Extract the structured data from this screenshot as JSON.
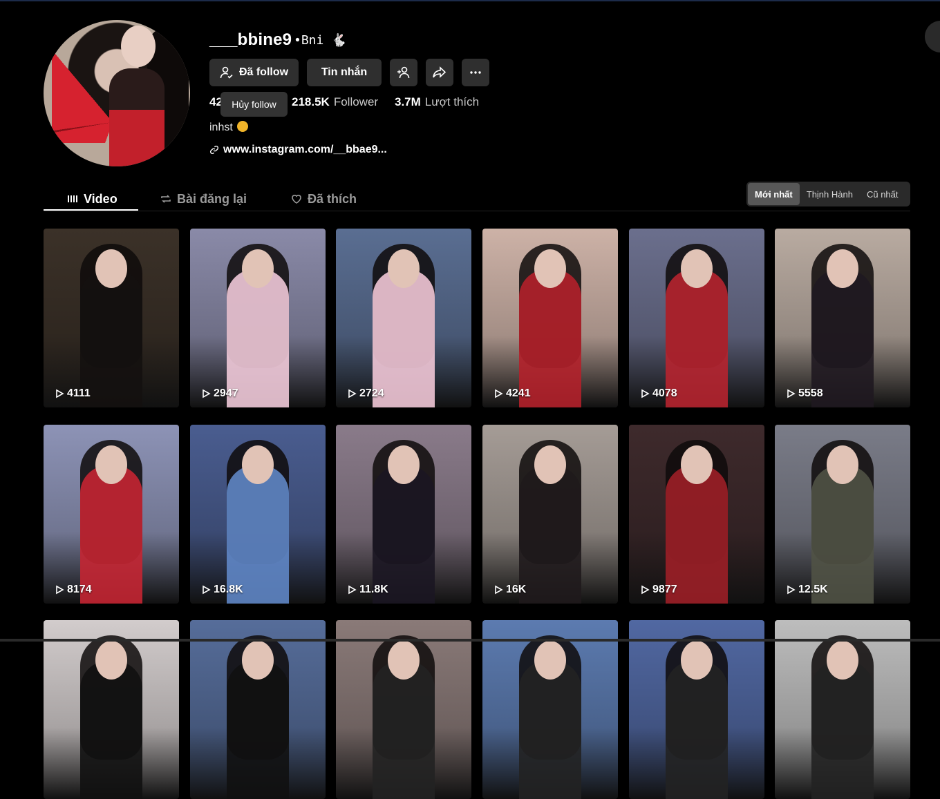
{
  "profile": {
    "username": "___bbine9",
    "nickname": "•Bni 🐇",
    "buttons": {
      "follow_label": "Đã follow",
      "message_label": "Tin nhắn"
    },
    "tooltip": "Hủy follow",
    "stats": {
      "following_value": "42",
      "follower_value": "218.5K",
      "follower_label": "Follower",
      "likes_value": "3.7M",
      "likes_label": "Lượt thích"
    },
    "bio": "inhst",
    "link": "www.instagram.com/__bbae9..."
  },
  "tabs": [
    {
      "label": "Video",
      "icon": "grid-icon",
      "active": true
    },
    {
      "label": "Bài đăng lại",
      "icon": "repost-icon",
      "active": false
    },
    {
      "label": "Đã thích",
      "icon": "heart-icon",
      "active": false
    }
  ],
  "sort": [
    {
      "label": "Mới nhất",
      "active": true
    },
    {
      "label": "Thịnh Hành",
      "active": false
    },
    {
      "label": "Cũ nhất",
      "active": false
    }
  ],
  "videos": [
    {
      "views": "4111",
      "bg": "#3b3128",
      "fig": "#141110"
    },
    {
      "views": "2947",
      "bg": "#8a8aa8",
      "fig": "#f0c9d8"
    },
    {
      "views": "2724",
      "bg": "#5a6e92",
      "fig": "#f1c6d6"
    },
    {
      "views": "4241",
      "bg": "#cdb2a7",
      "fig": "#b3202a"
    },
    {
      "views": "4078",
      "bg": "#6b6f8d",
      "fig": "#b6232f"
    },
    {
      "views": "5558",
      "bg": "#b9aba1",
      "fig": "#1f1820"
    },
    {
      "views": "8174",
      "bg": "#8d93b6",
      "fig": "#c42532"
    },
    {
      "views": "16.8K",
      "bg": "#4a5d90",
      "fig": "#5f86c5"
    },
    {
      "views": "11.8K",
      "bg": "#8a7b8a",
      "fig": "#1b1622"
    },
    {
      "views": "16K",
      "bg": "#a59c96",
      "fig": "#1f1a1c"
    },
    {
      "views": "9877",
      "bg": "#3e2a2c",
      "fig": "#9c1f27"
    },
    {
      "views": "12.5K",
      "bg": "#7a7c88",
      "fig": "#505245"
    },
    {
      "views": "",
      "bg": "#d2cccc",
      "fig": "#111"
    },
    {
      "views": "",
      "bg": "#566d9a",
      "fig": "#111"
    },
    {
      "views": "",
      "bg": "#8a7a78",
      "fig": "#222"
    },
    {
      "views": "",
      "bg": "#5c7bb0",
      "fig": "#222"
    },
    {
      "views": "",
      "bg": "#5168a2",
      "fig": "#222"
    },
    {
      "views": "",
      "bg": "#bdbdbd",
      "fig": "#222"
    }
  ]
}
